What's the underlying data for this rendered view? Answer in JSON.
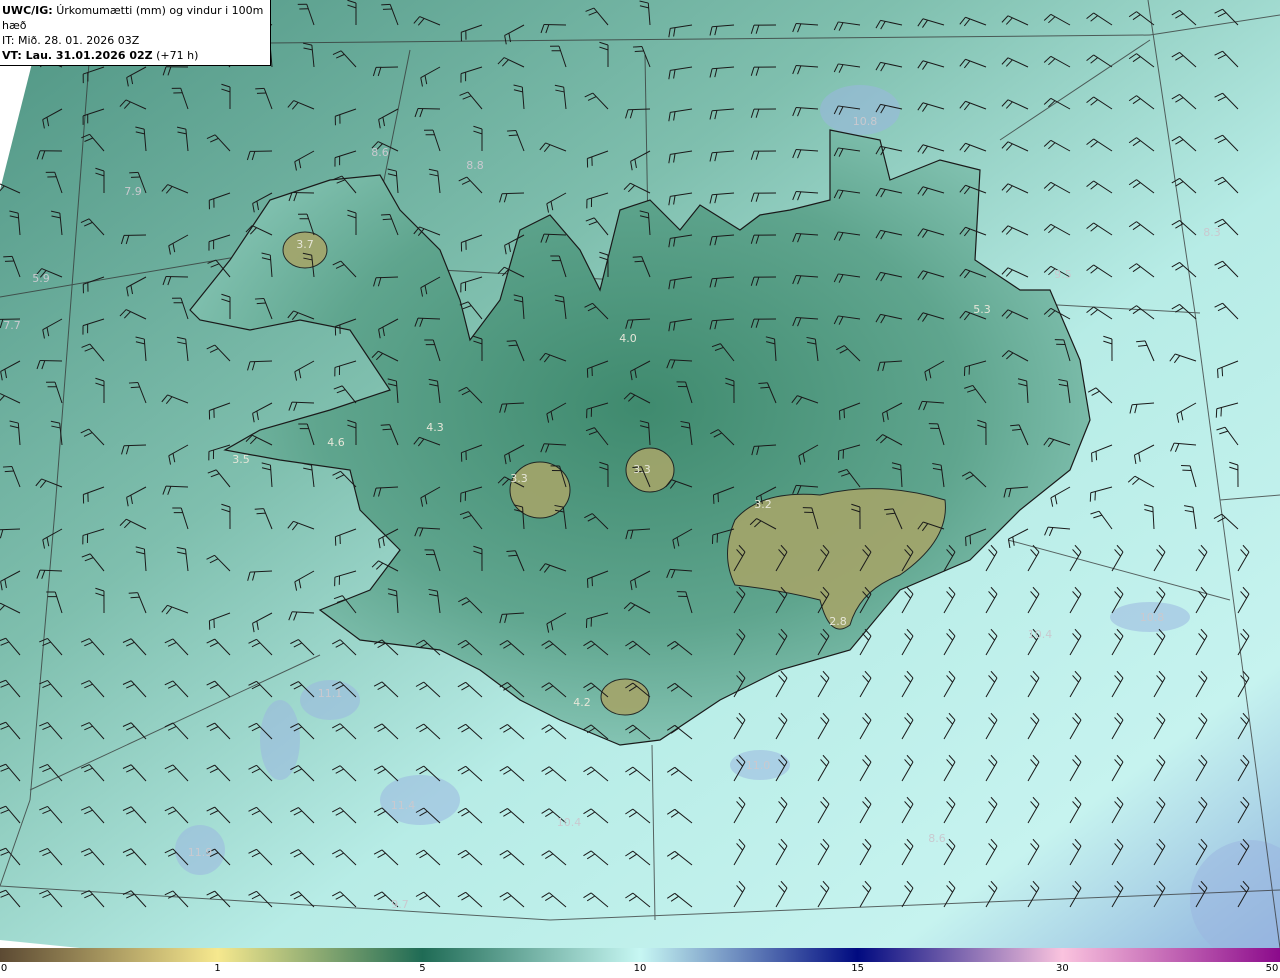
{
  "header": {
    "model": "UWC/IG:",
    "title": "Úrkomumætti (mm) og vindur i 100m hæð",
    "init_time": "IT: Mið. 28. 01. 2026 03Z",
    "valid_time": "VT: Lau. 31.01.2026 02Z",
    "lead": "(+71 h)"
  },
  "map": {
    "region": "Iceland",
    "value_labels": [
      "3.7",
      "5.9",
      "7.7",
      "7.9",
      "8.6",
      "8.8",
      "4.0",
      "5.3",
      "4.3",
      "4.6",
      "3.5",
      "3.3",
      "3.3",
      "3.2",
      "2.8",
      "4.2",
      "10.8",
      "8.3",
      "9.5",
      "10.4",
      "10.8",
      "8.6",
      "11.1",
      "11.4",
      "11.9",
      "11.0",
      "10.4",
      "9.7"
    ],
    "colors": {
      "land_line": "#1a1a1a",
      "sea_low": "#5e9e8c",
      "sea_high": "#c8f4f0",
      "glacier": "#a9a868",
      "blue_patch": "#9bb6e0"
    }
  },
  "colorbar": {
    "ticks": [
      "0",
      "1",
      "5",
      "10",
      "15",
      "30",
      "50"
    ],
    "stops": [
      "#5c4a33",
      "#f6e88e",
      "#1f6b55",
      "#c7f7f3",
      "#000a80",
      "#fac3de",
      "#8b0a8b"
    ]
  }
}
